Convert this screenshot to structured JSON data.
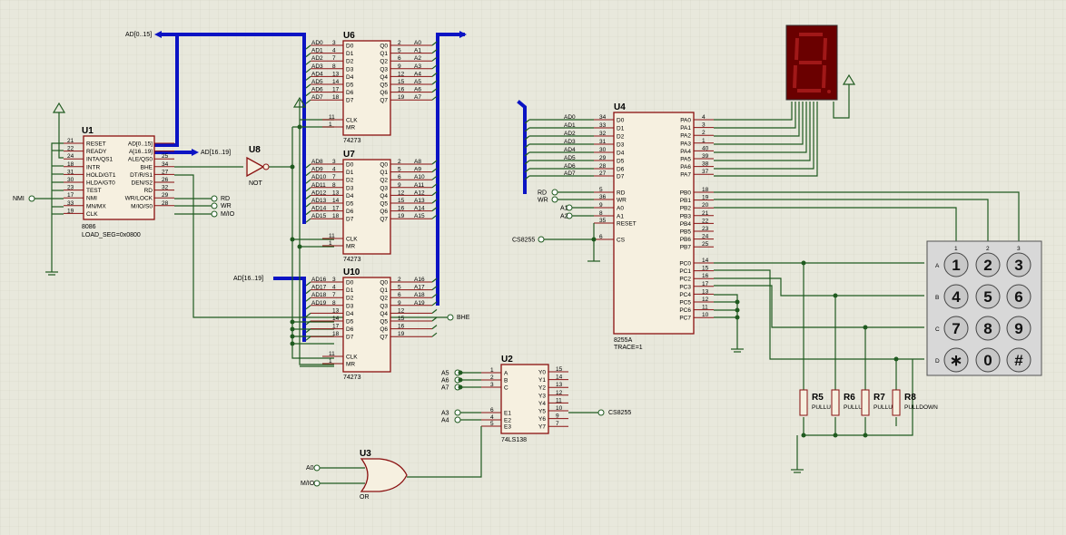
{
  "chips": {
    "u1": {
      "name": "U1",
      "type": "8086",
      "note": "LOAD_SEG=0x0800",
      "left_pins": [
        "RESET",
        "READY",
        "INTA/QS1",
        "INTR",
        "HOLD/GT1",
        "HLDA/GT0",
        "TEST",
        "NMI",
        "MN/MX",
        "CLK"
      ],
      "left_nums": [
        "21",
        "22",
        "24",
        "18",
        "31",
        "30",
        "23",
        "17",
        "33",
        "19"
      ],
      "right_pins": [
        "AD[0..15]",
        "A[16..19]",
        "ALE/QS0",
        "BHE",
        "DT/R/S1",
        "DEN/S2",
        "RD",
        "WR/LOCK",
        "M/IO/S0"
      ],
      "right_nums": [
        "",
        "",
        "25",
        "34",
        "27",
        "26",
        "32",
        "29",
        "28"
      ]
    },
    "u6": {
      "name": "U6",
      "type": "74273",
      "left_pins": [
        "D0",
        "D1",
        "D2",
        "D3",
        "D4",
        "D5",
        "D6",
        "D7",
        "CLK",
        "MR"
      ],
      "left_nums": [
        "3",
        "4",
        "7",
        "8",
        "13",
        "14",
        "17",
        "18",
        "11",
        "1"
      ],
      "right_pins": [
        "Q0",
        "Q1",
        "Q2",
        "Q3",
        "Q4",
        "Q5",
        "Q6",
        "Q7"
      ],
      "right_nums": [
        "2",
        "5",
        "6",
        "9",
        "12",
        "15",
        "16",
        "19"
      ],
      "in_labels": [
        "AD0",
        "AD1",
        "AD2",
        "AD3",
        "AD4",
        "AD5",
        "AD6",
        "AD7"
      ],
      "out_labels": [
        "A0",
        "A1",
        "A2",
        "A3",
        "A4",
        "A5",
        "A6",
        "A7"
      ]
    },
    "u7": {
      "name": "U7",
      "type": "74273",
      "left_pins": [
        "D0",
        "D1",
        "D2",
        "D3",
        "D4",
        "D5",
        "D6",
        "D7",
        "CLK",
        "MR"
      ],
      "left_nums": [
        "3",
        "4",
        "7",
        "8",
        "13",
        "14",
        "17",
        "18",
        "11",
        "1"
      ],
      "right_pins": [
        "Q0",
        "Q1",
        "Q2",
        "Q3",
        "Q4",
        "Q5",
        "Q6",
        "Q7"
      ],
      "right_nums": [
        "2",
        "5",
        "6",
        "9",
        "12",
        "15",
        "16",
        "19"
      ],
      "in_labels": [
        "AD8",
        "AD9",
        "AD10",
        "AD11",
        "AD12",
        "AD13",
        "AD14",
        "AD15"
      ],
      "out_labels": [
        "A8",
        "A9",
        "A10",
        "A11",
        "A12",
        "A13",
        "A14",
        "A15"
      ]
    },
    "u10": {
      "name": "U10",
      "type": "74273",
      "left_pins": [
        "D0",
        "D1",
        "D2",
        "D3",
        "D4",
        "D5",
        "D6",
        "D7",
        "CLK",
        "MR"
      ],
      "left_nums": [
        "3",
        "4",
        "7",
        "8",
        "13",
        "14",
        "17",
        "18",
        "11",
        "1"
      ],
      "right_pins": [
        "Q0",
        "Q1",
        "Q2",
        "Q3",
        "Q4",
        "Q5",
        "Q6",
        "Q7"
      ],
      "right_nums": [
        "2",
        "5",
        "6",
        "9",
        "12",
        "15",
        "16",
        "19"
      ],
      "in_labels": [
        "AD16",
        "AD17",
        "AD18",
        "AD19",
        "",
        "",
        "",
        ""
      ],
      "out_labels": [
        "A16",
        "A17",
        "A18",
        "A19",
        "",
        "",
        "",
        ""
      ]
    },
    "u2": {
      "name": "U2",
      "type": "74LS138",
      "left_pins": [
        "A",
        "B",
        "C",
        "E1",
        "E2",
        "E3"
      ],
      "left_nums": [
        "1",
        "2",
        "3",
        "6",
        "4",
        "5"
      ],
      "right_pins": [
        "Y0",
        "Y1",
        "Y2",
        "Y3",
        "Y4",
        "Y5",
        "Y6",
        "Y7"
      ],
      "right_nums": [
        "15",
        "14",
        "13",
        "12",
        "11",
        "10",
        "9",
        "7"
      ],
      "in_labels": [
        "A5",
        "A6",
        "A7",
        "A3",
        "A4"
      ]
    },
    "u4": {
      "name": "U4",
      "type": "8255A",
      "note": "TRACE=1",
      "left_pins": [
        "D0",
        "D1",
        "D2",
        "D3",
        "D4",
        "D5",
        "D6",
        "D7",
        "RD",
        "WR",
        "A0",
        "A1",
        "RESET",
        "CS"
      ],
      "left_nums": [
        "34",
        "33",
        "32",
        "31",
        "30",
        "29",
        "28",
        "27",
        "5",
        "36",
        "9",
        "8",
        "35",
        "6"
      ],
      "in_labels": [
        "AD0",
        "AD1",
        "AD2",
        "AD3",
        "AD4",
        "AD5",
        "AD6",
        "AD7"
      ],
      "ctrl_labels": [
        "RD",
        "WR",
        "A1",
        "A2",
        "CS8255"
      ],
      "pa_pins": [
        "PA0",
        "PA1",
        "PA2",
        "PA3",
        "PA4",
        "PA5",
        "PA6",
        "PA7"
      ],
      "pa_nums": [
        "4",
        "3",
        "2",
        "1",
        "40",
        "39",
        "38",
        "37"
      ],
      "pb_pins": [
        "PB0",
        "PB1",
        "PB2",
        "PB3",
        "PB4",
        "PB5",
        "PB6",
        "PB7"
      ],
      "pb_nums": [
        "18",
        "19",
        "20",
        "21",
        "22",
        "23",
        "24",
        "25"
      ],
      "pc_pins": [
        "PC0",
        "PC1",
        "PC2",
        "PC3",
        "PC4",
        "PC5",
        "PC6",
        "PC7"
      ],
      "pc_nums": [
        "14",
        "15",
        "16",
        "17",
        "13",
        "12",
        "11",
        "10"
      ]
    },
    "u8": {
      "name": "U8",
      "type": "NOT"
    },
    "u3": {
      "name": "U3",
      "type": "OR",
      "in_labels": [
        "A0",
        "M/IO"
      ]
    }
  },
  "nets": {
    "ad_bus": "AD[0..15]",
    "a_bus": "AD[16..19]",
    "a_bus_out": "AD[16..19]",
    "nmi": "NMI",
    "rd": "RD",
    "wr": "WR",
    "mio": "M/IO",
    "bhe": "BHE",
    "cs_out": "CS8255"
  },
  "keypad": {
    "rows": [
      "A",
      "B",
      "C",
      "D"
    ],
    "cols": [
      "1",
      "2",
      "3"
    ],
    "keys": [
      "1",
      "2",
      "3",
      "4",
      "5",
      "6",
      "7",
      "8",
      "9",
      "∗",
      "0",
      "#"
    ]
  },
  "resistors": [
    {
      "name": "R5",
      "value": "PULLUP"
    },
    {
      "name": "R6",
      "value": "PULLUP"
    },
    {
      "name": "R7",
      "value": "PULLUP"
    },
    {
      "name": "R8",
      "value": "PULLDOWN"
    }
  ],
  "colors": {
    "wire": "#1f5a1f",
    "bus": "#0b13c4",
    "chip_border": "#8a1010",
    "chip_fill": "#f6f0e0",
    "display": "#7a0000",
    "background": "#e8e8dc"
  }
}
